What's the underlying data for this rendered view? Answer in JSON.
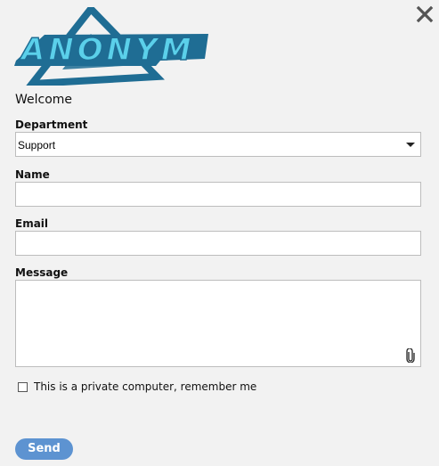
{
  "logo": {
    "text": "ANONYM",
    "colors": {
      "triangle": "#1f6d94",
      "text": "#5bd0ea"
    }
  },
  "heading": {
    "welcome": "Welcome"
  },
  "form": {
    "department": {
      "label": "Department",
      "value": "Support"
    },
    "name": {
      "label": "Name",
      "value": ""
    },
    "email": {
      "label": "Email",
      "value": ""
    },
    "message": {
      "label": "Message",
      "value": ""
    },
    "remember": {
      "label": "This is a private computer, remember me",
      "checked": false
    },
    "send_label": "Send"
  },
  "icons": {
    "close": "close-icon",
    "dropdown": "chevron-down-icon",
    "attach": "paperclip-icon"
  },
  "colors": {
    "background": "#f2f2f2",
    "send_button": "#5d93d1"
  }
}
